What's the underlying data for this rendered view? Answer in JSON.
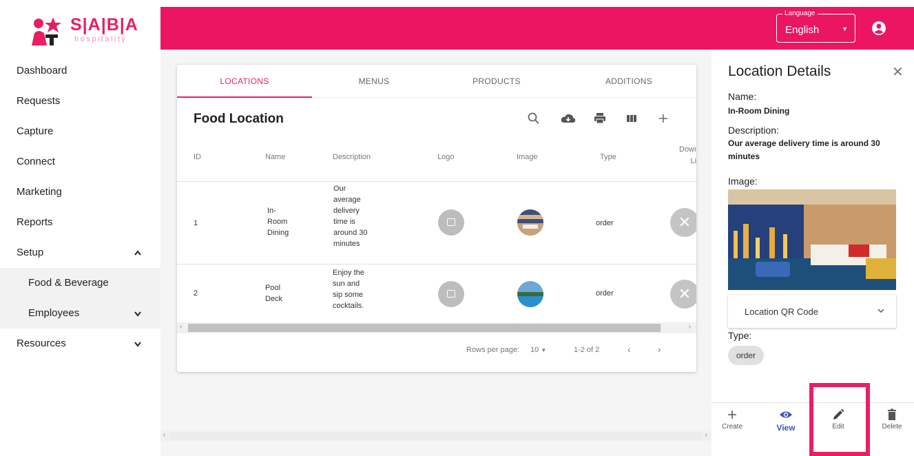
{
  "brand": {
    "name": "S|A|B|A",
    "tagline": "hospitality"
  },
  "colors": {
    "primary": "#ec1562",
    "accent": "#e91e63",
    "view_blue": "#3f51b5"
  },
  "sidebar": {
    "items": [
      {
        "label": "Dashboard"
      },
      {
        "label": "Requests"
      },
      {
        "label": "Capture"
      },
      {
        "label": "Connect"
      },
      {
        "label": "Marketing"
      },
      {
        "label": "Reports"
      },
      {
        "label": "Setup",
        "expanded": true
      },
      {
        "label": "Food & Beverage"
      },
      {
        "label": "Employees",
        "expanded": false
      },
      {
        "label": "Resources",
        "expanded": false
      }
    ]
  },
  "topbar": {
    "language_label": "Language",
    "language_value": "English",
    "account_icon": "account-circle-icon"
  },
  "tabs": [
    {
      "label": "LOCATIONS",
      "active": true
    },
    {
      "label": "MENUS"
    },
    {
      "label": "PRODUCTS"
    },
    {
      "label": "ADDITIONS"
    }
  ],
  "table": {
    "title": "Food Location",
    "toolbar_icons": [
      "search-icon",
      "cloud-download-icon",
      "print-icon",
      "columns-icon",
      "add-icon"
    ],
    "columns": {
      "id": "ID",
      "name": "Name",
      "description": "Description",
      "logo": "Logo",
      "image": "Image",
      "type": "Type",
      "download_1": "Downlo",
      "download_2": "Link"
    },
    "rows": [
      {
        "id": "1",
        "name": [
          "In-",
          "Room",
          "Dining"
        ],
        "description": [
          "Our",
          "average",
          "delivery",
          "time is",
          "around 30",
          "minutes"
        ],
        "type": "order"
      },
      {
        "id": "2",
        "name": [
          "Pool",
          "Deck"
        ],
        "description": [
          "Enjoy the",
          "sun and",
          "sip some",
          "cocktails."
        ],
        "type": "order"
      }
    ],
    "pagination": {
      "rows_per_page_label": "Rows per page:",
      "rows_per_page": "10",
      "range": "1-2 of 2"
    }
  },
  "details": {
    "title": "Location Details",
    "name_label": "Name:",
    "name_value": "In-Room Dining",
    "description_label": "Description:",
    "description_value": "Our average delivery time is around 30 minutes",
    "image_label": "Image:",
    "qr_label": "Location QR Code",
    "type_label": "Type:",
    "type_value": "order",
    "actions": {
      "create": "Create",
      "view": "View",
      "edit": "Edit",
      "delete": "Delete"
    }
  }
}
